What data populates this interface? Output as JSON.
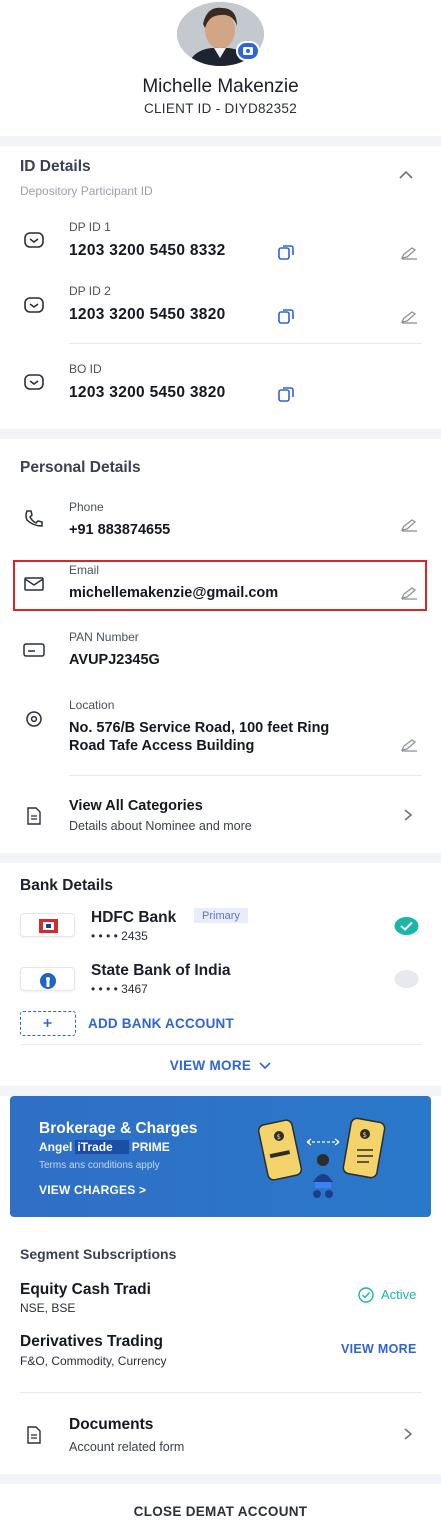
{
  "profile": {
    "name": "Michelle Makenzie",
    "client_id": "CLIENT ID -  DIYD82352"
  },
  "id_details": {
    "title": "ID Details",
    "subtitle": "Depository Participant ID",
    "items": [
      {
        "label": "DP ID 1",
        "value": "1203 3200 5450 8332"
      },
      {
        "label": "DP ID 2",
        "value": "1203 3200 5450 3820"
      },
      {
        "label": "BO ID",
        "value": "1203 3200 5450 3820"
      }
    ]
  },
  "personal_details": {
    "title": "Personal Details",
    "phone": {
      "label": "Phone",
      "value": "+91 883874655"
    },
    "email": {
      "label": "Email",
      "value": "michellemakenzie@gmail.com"
    },
    "pan": {
      "label": "PAN Number",
      "value": "AVUPJ2345G"
    },
    "location": {
      "label": "Location",
      "line1": "No. 576/B Service Road, 100 feet Ring",
      "line2": "Road Tafe Access Building"
    },
    "view_all": {
      "title": "View All Categories",
      "subtitle": "Details about Nominee and more"
    }
  },
  "bank_details": {
    "title": "Bank Details",
    "banks": [
      {
        "name": "HDFC Bank",
        "badge": "Primary",
        "account": "• • • • 2435"
      },
      {
        "name": "State Bank of India",
        "account": "• • • • 3467"
      }
    ],
    "add_label": "ADD BANK ACCOUNT",
    "view_more": "VIEW MORE"
  },
  "promo": {
    "title": "Brokerage & Charges",
    "brand_left": "Angel",
    "brand_mid": "iTrade",
    "brand_right": "PRIME",
    "terms": "Terms ans conditions apply",
    "link": "VIEW CHARGES >"
  },
  "segments": {
    "title": "Segment Subscriptions",
    "equity": {
      "title": "Equity Cash Tradi",
      "sub": "NSE, BSE",
      "status": "Active"
    },
    "derivatives": {
      "title": "Derivatives Trading",
      "sub": "F&O, Commodity, Currency",
      "action": "VIEW MORE"
    }
  },
  "documents": {
    "title": "Documents",
    "subtitle": "Account related form"
  },
  "footer": {
    "close_label": "CLOSE DEMAT ACCOUNT"
  },
  "colors": {
    "accent": "#2f64d8",
    "success": "#1cb5a9",
    "highlight": "#d9262c"
  }
}
